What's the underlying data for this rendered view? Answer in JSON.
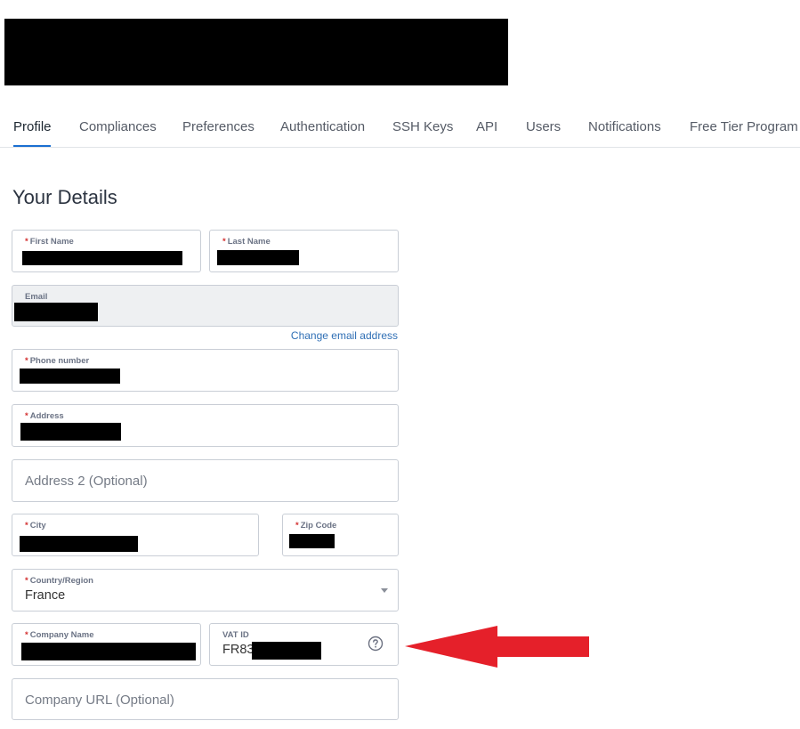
{
  "header": {
    "logo_redacted": true
  },
  "tabs": [
    {
      "label": "Profile",
      "active": true
    },
    {
      "label": "Compliances"
    },
    {
      "label": "Preferences"
    },
    {
      "label": "Authentication"
    },
    {
      "label": "SSH Keys"
    },
    {
      "label": "API"
    },
    {
      "label": "Users"
    },
    {
      "label": "Notifications"
    },
    {
      "label": "Free Tier Program"
    }
  ],
  "page": {
    "title": "Your Details"
  },
  "form": {
    "required_marker": "*",
    "first_name": {
      "label": "First Name",
      "value_redacted": true
    },
    "last_name": {
      "label": "Last Name",
      "value_redacted": true
    },
    "email": {
      "label": "Email",
      "value_redacted": true,
      "readonly": true
    },
    "change_email_link": "Change email address",
    "phone": {
      "label": "Phone number",
      "value_redacted": true
    },
    "address": {
      "label": "Address",
      "value_redacted": true
    },
    "address2": {
      "placeholder": "Address 2 (Optional)"
    },
    "city": {
      "label": "City",
      "value_redacted": true
    },
    "zip": {
      "label": "Zip Code",
      "value_redacted": true
    },
    "country": {
      "label": "Country/Region",
      "value": "France"
    },
    "company_name": {
      "label": "Company Name",
      "value_redacted": true
    },
    "vat_id": {
      "label": "VAT ID",
      "value_prefix": "FR83",
      "value_rest_redacted": true,
      "icon": "help-circle-icon"
    },
    "company_url": {
      "placeholder": "Company URL (Optional)"
    }
  },
  "annotation": {
    "type": "arrow",
    "color": "#e5202a",
    "points_to": "vat_id"
  },
  "colors": {
    "accent": "#1a6fd1",
    "link": "#2f6fb5",
    "required": "#d32f2f"
  }
}
